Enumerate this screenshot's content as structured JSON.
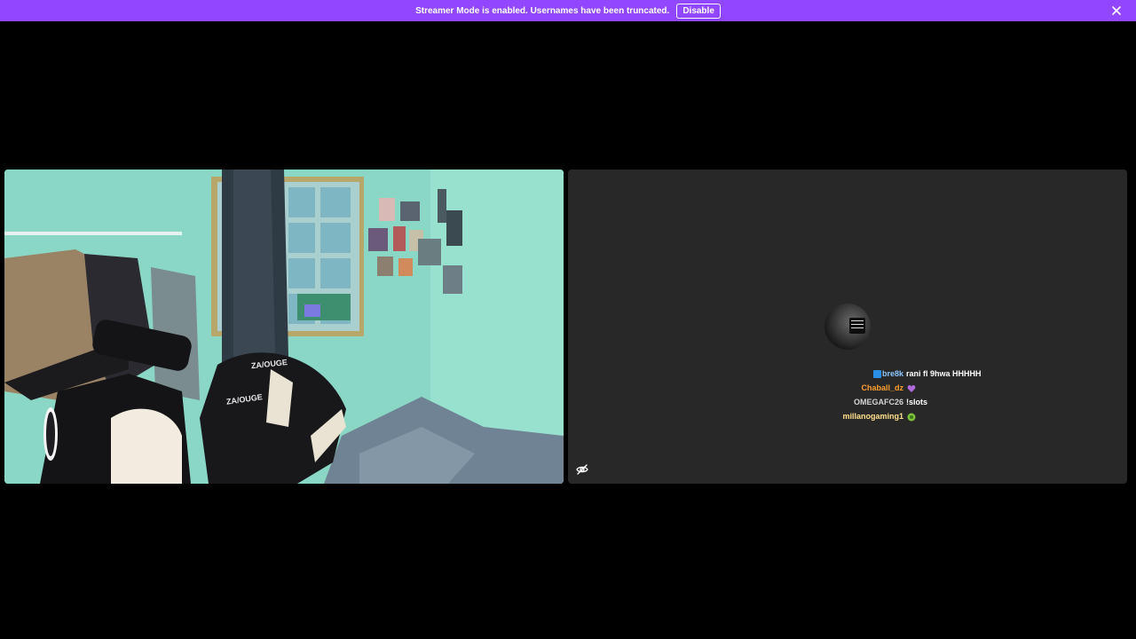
{
  "banner": {
    "message": "Streamer Mode is enabled. Usernames have been truncated.",
    "disable_label": "Disable",
    "background": "#9147ff"
  },
  "camera_overlay": {
    "chair_brand_top": "ZA/OUGE",
    "chair_brand_bottom": "ZA/OUGE"
  },
  "chat": {
    "messages": [
      {
        "user": "bre8k",
        "user_color": "#8cc6ff",
        "badge": "sub-badge-icon",
        "text": "rani fl 9hwa HHHHH"
      },
      {
        "user": "Chaball_dz",
        "user_color": "#ff9f2e",
        "emote": "heart-emote-icon",
        "text": ""
      },
      {
        "user": "OMEGAFC26",
        "user_color": "#d4d4d4",
        "text": "!slots"
      },
      {
        "user": "millanogaming1",
        "user_color": "#ffe08a",
        "emote": "green-emote-icon",
        "text": ""
      }
    ]
  }
}
